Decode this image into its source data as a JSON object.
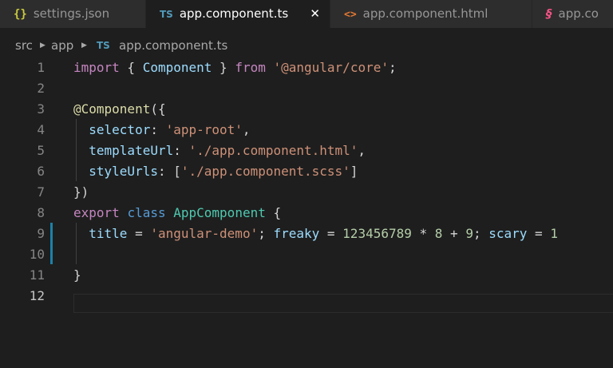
{
  "tabs": [
    {
      "icon": "{}",
      "label": "settings.json",
      "active": false
    },
    {
      "icon": "TS",
      "label": "app.component.ts",
      "active": true,
      "close": "✕"
    },
    {
      "icon": "<>",
      "label": "app.component.html",
      "active": false
    },
    {
      "icon": "§",
      "label": "app.co",
      "active": false
    }
  ],
  "breadcrumb": {
    "folder1": "src",
    "folder2": "app",
    "file_icon": "TS",
    "file": "app.component.ts"
  },
  "editor": {
    "line_numbers": [
      "1",
      "2",
      "3",
      "4",
      "5",
      "6",
      "7",
      "8",
      "9",
      "10",
      "11",
      "12"
    ],
    "active_line": 12,
    "modified_lines": [
      9,
      10
    ],
    "lines": [
      [
        [
          "kw2",
          "import"
        ],
        [
          "pun",
          " { "
        ],
        [
          "prop",
          "Component"
        ],
        [
          "pun",
          " } "
        ],
        [
          "kw2",
          "from"
        ],
        [
          "pun",
          " "
        ],
        [
          "str",
          "'@angular/core'"
        ],
        [
          "pun",
          ";"
        ]
      ],
      [],
      [
        [
          "dec",
          "@Component"
        ],
        [
          "pun",
          "({"
        ]
      ],
      [
        [
          "pun",
          "  "
        ],
        [
          "prop",
          "selector"
        ],
        [
          "pun",
          ": "
        ],
        [
          "str",
          "'app-root'"
        ],
        [
          "pun",
          ","
        ]
      ],
      [
        [
          "pun",
          "  "
        ],
        [
          "prop",
          "templateUrl"
        ],
        [
          "pun",
          ": "
        ],
        [
          "str",
          "'./app.component.html'"
        ],
        [
          "pun",
          ","
        ]
      ],
      [
        [
          "pun",
          "  "
        ],
        [
          "prop",
          "styleUrls"
        ],
        [
          "pun",
          ": ["
        ],
        [
          "str",
          "'./app.component.scss'"
        ],
        [
          "pun",
          "]"
        ]
      ],
      [
        [
          "pun",
          "})"
        ]
      ],
      [
        [
          "kw2",
          "export"
        ],
        [
          "pun",
          " "
        ],
        [
          "kw",
          "class"
        ],
        [
          "pun",
          " "
        ],
        [
          "cls",
          "AppComponent"
        ],
        [
          "pun",
          " {"
        ]
      ],
      [
        [
          "pun",
          "  "
        ],
        [
          "prop",
          "title"
        ],
        [
          "pun",
          " = "
        ],
        [
          "str",
          "'angular-demo'"
        ],
        [
          "pun",
          "; "
        ],
        [
          "prop",
          "freaky"
        ],
        [
          "pun",
          " = "
        ],
        [
          "num",
          "123456789"
        ],
        [
          "pun",
          " * "
        ],
        [
          "num",
          "8"
        ],
        [
          "pun",
          " + "
        ],
        [
          "num",
          "9"
        ],
        [
          "pun",
          "; "
        ],
        [
          "prop",
          "scary"
        ],
        [
          "pun",
          " = "
        ],
        [
          "num",
          "1"
        ]
      ],
      [],
      [
        [
          "pun",
          "}"
        ]
      ],
      []
    ]
  }
}
